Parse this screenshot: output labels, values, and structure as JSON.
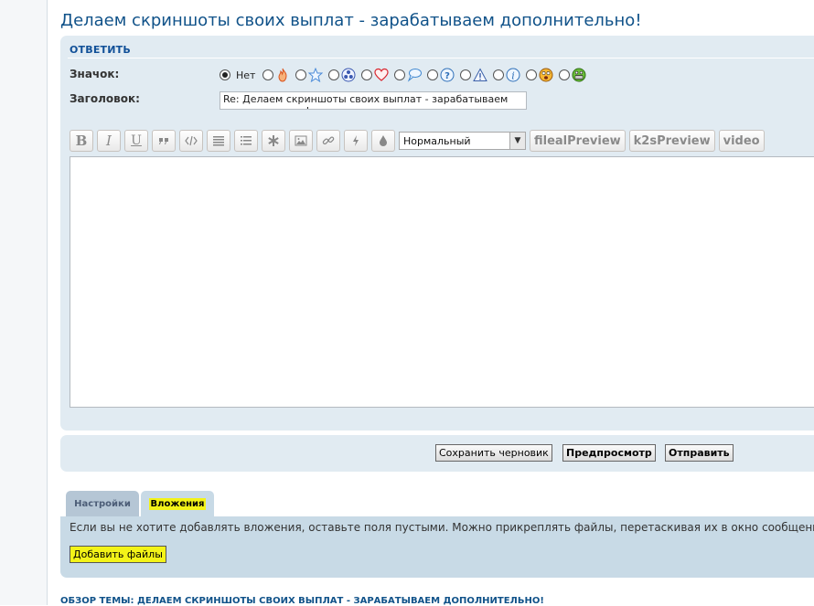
{
  "topic": {
    "title": "Делаем скриншоты своих выплат - зарабатываем дополнительно!"
  },
  "reply": {
    "heading": "ОТВЕТИТЬ",
    "icon_label": "Значок:",
    "icon_none_label": "Нет",
    "post_icons": [
      "fire-icon",
      "star-icon",
      "radioactive-icon",
      "heart-icon",
      "speech-bubble-icon",
      "question-icon",
      "warning-icon",
      "info-icon",
      "surprised-smiley-icon",
      "grin-smiley-icon"
    ],
    "subject_label": "Заголовок:",
    "subject_value": "Re: Делаем скриншоты своих выплат - зарабатываем дополнительно!"
  },
  "toolbar": {
    "bold": "B",
    "italic": "I",
    "underline": "U",
    "font_size_selected": "Нормальный",
    "extra_buttons": [
      "filealPreview",
      "k2sPreview",
      "video"
    ]
  },
  "actions": {
    "save_draft": "Сохранить черновик",
    "preview": "Предпросмотр",
    "submit": "Отправить"
  },
  "tabs": {
    "options": "Настройки",
    "attachments": "Вложения"
  },
  "attachments": {
    "hint": "Если вы не хотите добавлять вложения, оставьте поля пустыми. Можно прикреплять файлы, перетаскивая их в окно сообщения.",
    "add_files": "Добавить файлы"
  },
  "review": {
    "heading": "ОБЗОР ТЕМЫ: ДЕЛАЕМ СКРИНШОТЫ СВОИХ ВЫПЛАТ - ЗАРАБАТЫВАЕМ ДОПОЛНИТЕЛЬНО!"
  },
  "colors": {
    "link_blue": "#105289",
    "panel_bg": "#e1ebf2",
    "highlight_yellow": "#f3f318"
  }
}
